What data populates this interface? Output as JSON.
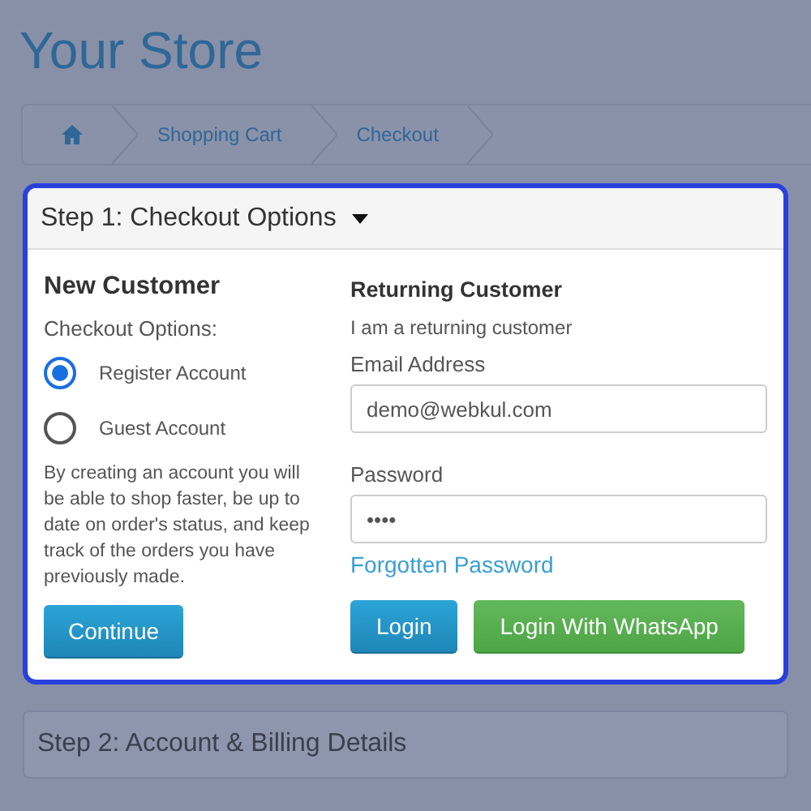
{
  "store_title": "Your Store",
  "breadcrumb": [
    {
      "kind": "home"
    },
    {
      "kind": "link",
      "label": "Shopping Cart"
    },
    {
      "kind": "link",
      "label": "Checkout"
    }
  ],
  "step1": {
    "title": "Step 1: Checkout Options",
    "expanded": true,
    "new_customer": {
      "heading": "New Customer",
      "options_label": "Checkout Options:",
      "options": [
        {
          "label": "Register Account",
          "selected": true
        },
        {
          "label": "Guest Account",
          "selected": false
        }
      ],
      "description": "By creating an account you will be able to shop faster, be up to date on order's status, and keep track of  the orders you have previously made.",
      "button": "Continue"
    },
    "returning_customer": {
      "heading": "Returning Customer",
      "subtitle": "I am a returning customer",
      "email_label": "Email Address",
      "email_value": "demo@webkul.com",
      "password_label": "Password",
      "password_value": "••••",
      "forgot_link": "Forgotten Password",
      "buttons": [
        {
          "kind": "primary",
          "label": "Login"
        },
        {
          "kind": "whatsapp",
          "label": "Login With WhatsApp"
        }
      ]
    }
  },
  "step2": {
    "title": "Step 2: Account & Billing Details"
  }
}
